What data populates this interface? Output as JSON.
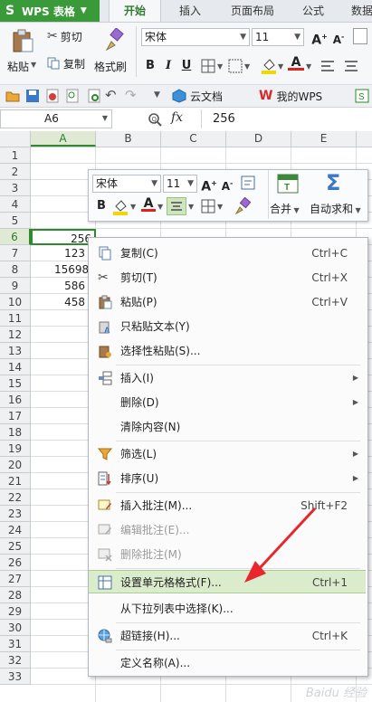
{
  "app": {
    "name": "WPS 表格"
  },
  "tabs": [
    "开始",
    "插入",
    "页面布局",
    "公式",
    "数据"
  ],
  "ribbon": {
    "paste": "粘贴",
    "cut": "剪切",
    "copy": "复制",
    "format_painter": "格式刷",
    "font_name": "宋体",
    "font_size": "11",
    "bold": "B",
    "italic": "I",
    "underline": "U",
    "increase_font": "A+",
    "decrease_font": "A-",
    "fill_color": "#f2d600",
    "font_color": "#e0201b"
  },
  "quick_access": {
    "cloud_docs": "云文档",
    "my_wps": "我的WPS"
  },
  "formula_bar": {
    "name_box": "A6",
    "fx": "fx",
    "value": "256"
  },
  "grid": {
    "columns": [
      "A",
      "B",
      "C",
      "D",
      "E"
    ],
    "rows": [
      "1",
      "2",
      "3",
      "4",
      "5",
      "6",
      "7",
      "8",
      "9",
      "10",
      "11",
      "12",
      "13",
      "14",
      "15",
      "16",
      "17",
      "18",
      "19",
      "20",
      "21",
      "22",
      "23",
      "24",
      "25",
      "26",
      "27",
      "28",
      "29",
      "30",
      "31",
      "32",
      "33"
    ],
    "cells_A": {
      "6": "256",
      "7": "123",
      "8": "15698",
      "9": "586",
      "10": "458"
    }
  },
  "mini_toolbar": {
    "font_name": "宋体",
    "font_size": "11",
    "merge": "合并",
    "autosum": "自动求和"
  },
  "context_menu": [
    {
      "label": "复制(C)",
      "shortcut": "Ctrl+C"
    },
    {
      "label": "剪切(T)",
      "shortcut": "Ctrl+X"
    },
    {
      "label": "粘贴(P)",
      "shortcut": "Ctrl+V"
    },
    {
      "label": "只粘贴文本(Y)",
      "shortcut": ""
    },
    {
      "label": "选择性粘贴(S)...",
      "shortcut": ""
    },
    {
      "label": "插入(I)",
      "shortcut": ""
    },
    {
      "label": "删除(D)",
      "shortcut": ""
    },
    {
      "label": "清除内容(N)",
      "shortcut": ""
    },
    {
      "label": "筛选(L)",
      "shortcut": ""
    },
    {
      "label": "排序(U)",
      "shortcut": ""
    },
    {
      "label": "插入批注(M)...",
      "shortcut": "Shift+F2"
    },
    {
      "label": "编辑批注(E)...",
      "shortcut": ""
    },
    {
      "label": "删除批注(M)",
      "shortcut": ""
    },
    {
      "label": "设置单元格格式(F)...",
      "shortcut": "Ctrl+1"
    },
    {
      "label": "从下拉列表中选择(K)...",
      "shortcut": ""
    },
    {
      "label": "超链接(H)...",
      "shortcut": "Ctrl+K"
    },
    {
      "label": "定义名称(A)...",
      "shortcut": ""
    }
  ],
  "colors": {
    "accent_green": "#3a9a3a",
    "highlight": "#dbeccd",
    "arrow_red": "#e8262b"
  },
  "watermark": "Baidu 经验"
}
